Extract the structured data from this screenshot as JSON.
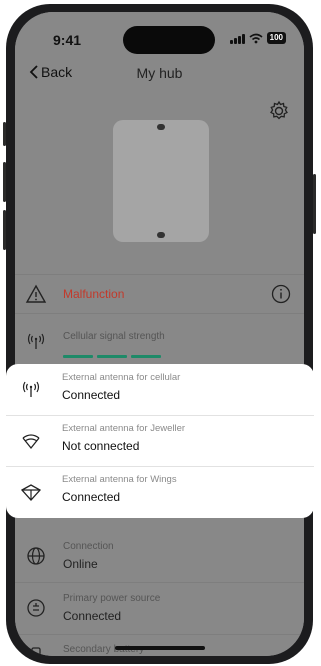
{
  "status_bar": {
    "time": "9:41",
    "battery": "100"
  },
  "nav": {
    "back_label": "Back",
    "title": "My hub"
  },
  "colors": {
    "malfunction": "#c23a2b",
    "signal": "#1e8a68",
    "card_bg": "#ffffff",
    "screen_dim": "#888888"
  },
  "rows": {
    "malfunction": {
      "label": "Malfunction",
      "icon": "warning-icon",
      "info_icon": "info-icon"
    },
    "cellular_signal": {
      "label": "Cellular signal strength",
      "icon": "cellular-antenna-icon",
      "level": 3
    },
    "connection": {
      "label": "Connection",
      "value": "Online",
      "icon": "globe-icon"
    },
    "primary_power": {
      "label": "Primary power source",
      "value": "Connected",
      "icon": "power-plug-icon"
    },
    "secondary_battery": {
      "label": "Secondary battery",
      "icon": "battery-icon"
    }
  },
  "card": {
    "items": [
      {
        "label": "External antenna for cellular",
        "value": "Connected",
        "icon": "cellular-antenna-icon"
      },
      {
        "label": "External antenna for Jeweller",
        "value": "Not connected",
        "icon": "jeweller-antenna-icon"
      },
      {
        "label": "External antenna for Wings",
        "value": "Connected",
        "icon": "wings-antenna-icon"
      }
    ]
  },
  "icons": {
    "settings": "gear-icon",
    "back": "chevron-left-icon",
    "device": "hub-device-image"
  }
}
